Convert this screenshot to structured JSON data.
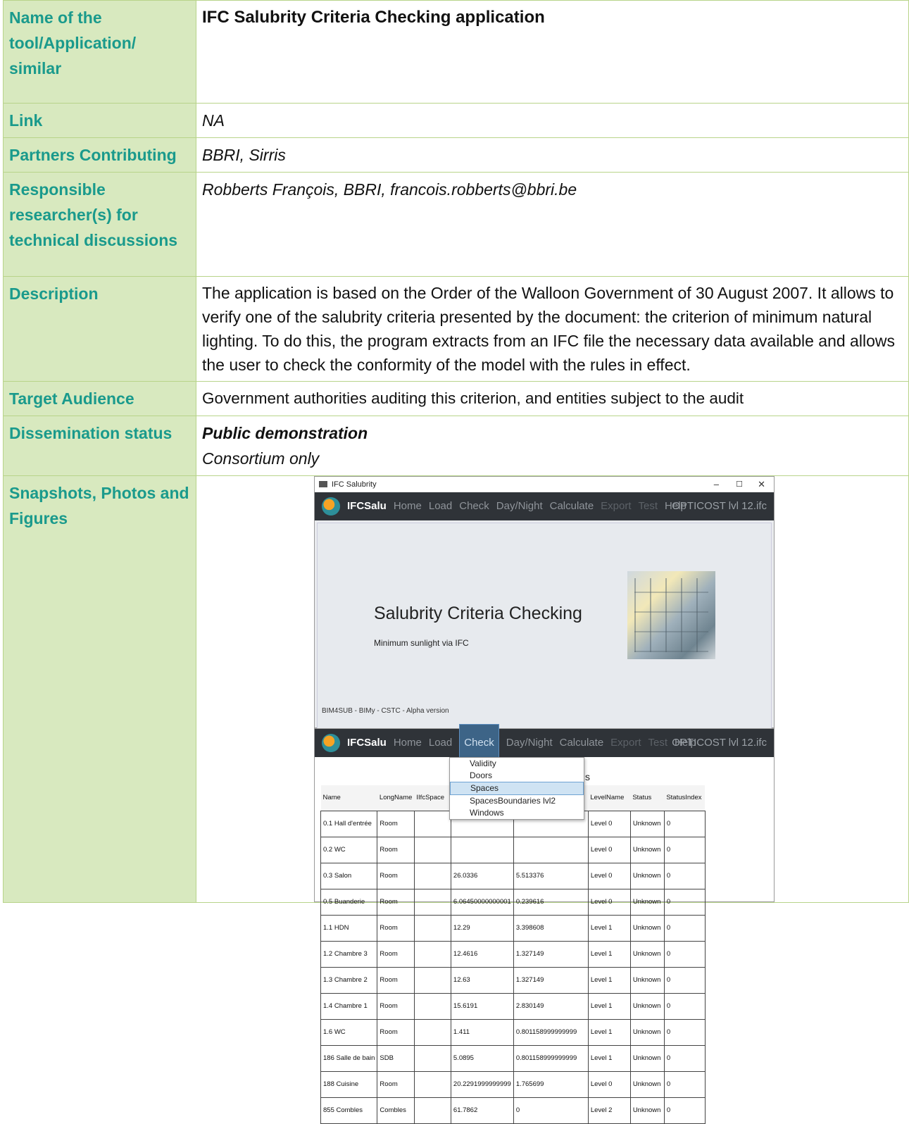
{
  "rows": [
    {
      "label": "Name of the tool/Application/ similar",
      "value": "IFC Salubrity Criteria Checking application"
    },
    {
      "label": "Link",
      "value": "NA"
    },
    {
      "label": "Partners Contributing",
      "value": "BBRI, Sirris"
    },
    {
      "label": "Responsible researcher(s) for technical discussions",
      "value": "Robberts François, BBRI, francois.robberts@bbri.be"
    },
    {
      "label": "Description",
      "value": "The application is based on the Order of the Walloon Government of 30 August 2007. It allows to verify one of the salubrity criteria presented by the document: the criterion of minimum natural lighting. To do this, the program extracts from an IFC file the necessary data available and allows the user to check the conformity of the model with the rules in effect."
    },
    {
      "label": "Target Audience",
      "value": "Government authorities auditing this criterion, and entities subject to the audit"
    },
    {
      "label": "Dissemination status",
      "value_bold": "Public demonstration",
      "value_italic": "Consortium only"
    },
    {
      "label": "Snapshots, Photos and Figures"
    }
  ],
  "app": {
    "window_title": "IFC Salubrity",
    "window_controls": [
      "–",
      "☐",
      "✕"
    ],
    "app_name": "IFCSalu",
    "menu": [
      "Home",
      "Load",
      "Check",
      "Day/Night",
      "Calculate",
      "Export",
      "Test",
      "Help"
    ],
    "file_name": "OPTICOST lvl 12.ifc",
    "splash_title": "Salubrity Criteria Checking",
    "splash_subtitle": "Minimum sunlight via IFC",
    "splash_footer": "BIM4SUB - BIMy - CSTC - Alpha version",
    "check_menu": [
      "Validity",
      "Doors",
      "Spaces",
      "SpacesBoundaries lvl2",
      "Windows"
    ],
    "selected_item": "Spaces",
    "heading_fragment": "s",
    "columns": [
      "Name",
      "LongName",
      "IIfcSpace",
      "",
      "",
      "LevelName",
      "Status",
      "StatusIndex"
    ],
    "table_rows": [
      [
        "0.1 Hall d'entrée",
        "Room",
        "",
        "",
        "",
        "Level 0",
        "Unknown",
        "0"
      ],
      [
        "0.2 WC",
        "Room",
        "",
        "",
        "",
        "Level 0",
        "Unknown",
        "0"
      ],
      [
        "0.3 Salon",
        "Room",
        "",
        "26.0336",
        "5.513376",
        "Level 0",
        "Unknown",
        "0"
      ],
      [
        "0.5 Buanderie",
        "Room",
        "",
        "6.06450000000001",
        "0.239616",
        "Level 0",
        "Unknown",
        "0"
      ],
      [
        "1.1 HDN",
        "Room",
        "",
        "12.29",
        "3.398608",
        "Level 1",
        "Unknown",
        "0"
      ],
      [
        "1.2 Chambre 3",
        "Room",
        "",
        "12.4616",
        "1.327149",
        "Level 1",
        "Unknown",
        "0"
      ],
      [
        "1.3 Chambre 2",
        "Room",
        "",
        "12.63",
        "1.327149",
        "Level 1",
        "Unknown",
        "0"
      ],
      [
        "1.4 Chambre 1",
        "Room",
        "",
        "15.6191",
        "2.830149",
        "Level 1",
        "Unknown",
        "0"
      ],
      [
        "1.6 WC",
        "Room",
        "",
        "1.411",
        "0.801158999999999",
        "Level 1",
        "Unknown",
        "0"
      ],
      [
        "186 Salle de bain",
        "SDB",
        "",
        "5.0895",
        "0.801158999999999",
        "Level 1",
        "Unknown",
        "0"
      ],
      [
        "188 Cuisine",
        "Room",
        "",
        "20.2291999999999",
        "1.765699",
        "Level 0",
        "Unknown",
        "0"
      ],
      [
        "855 Combles",
        "Combles",
        "",
        "61.7862",
        "0",
        "Level 2",
        "Unknown",
        "0"
      ]
    ]
  }
}
